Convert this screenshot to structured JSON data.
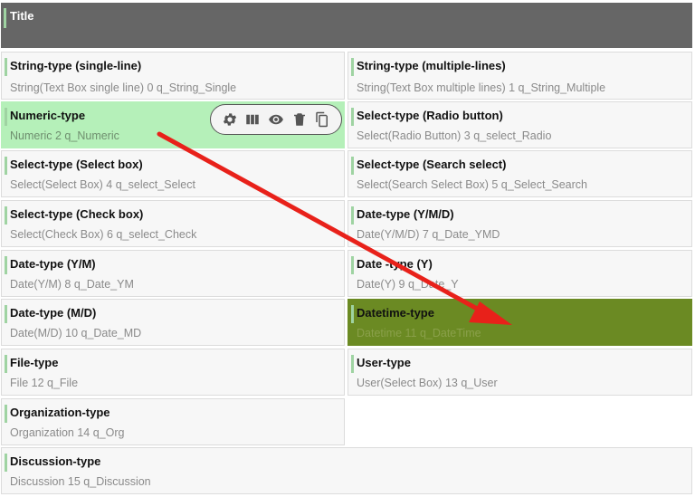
{
  "title": "Title",
  "fields": [
    {
      "label": "String-type (single-line)",
      "desc": "String(Text Box single line) 0 q_String_Single"
    },
    {
      "label": "String-type (multiple-lines)",
      "desc": "String(Text Box multiple lines) 1 q_String_Multiple"
    },
    {
      "label": "Numeric-type",
      "desc": "Numeric 2 q_Numeric"
    },
    {
      "label": "Select-type (Radio button)",
      "desc": "Select(Radio Button) 3 q_select_Radio"
    },
    {
      "label": "Select-type (Select box)",
      "desc": "Select(Select Box) 4 q_select_Select"
    },
    {
      "label": "Select-type (Search select)",
      "desc": "Select(Search Select Box) 5 q_Select_Search"
    },
    {
      "label": "Select-type (Check box)",
      "desc": "Select(Check Box) 6 q_select_Check"
    },
    {
      "label": "Date-type (Y/M/D)",
      "desc": "Date(Y/M/D) 7 q_Date_YMD"
    },
    {
      "label": "Date-type (Y/M)",
      "desc": "Date(Y/M) 8 q_Date_YM"
    },
    {
      "label": "Date -type (Y)",
      "desc": "Date(Y) 9 q_Date_Y"
    },
    {
      "label": "Date-type (M/D)",
      "desc": "Date(M/D) 10 q_Date_MD"
    },
    {
      "label": "Datetime-type",
      "desc": "Datetime 11 q_DateTime"
    },
    {
      "label": "File-type",
      "desc": "File 12 q_File"
    },
    {
      "label": "User-type",
      "desc": "User(Select Box) 13 q_User"
    },
    {
      "label": "Organization-type",
      "desc": "Organization 14 q_Org"
    },
    {
      "label": "Discussion-type",
      "desc": "Discussion 15 q_Discussion"
    }
  ],
  "toolbar_icons": [
    "gear-icon",
    "columns-icon",
    "eye-icon",
    "trash-icon",
    "copy-icon"
  ],
  "colors": {
    "title_bg": "#666666",
    "selected_bg": "#b5f0b9",
    "highlight_bg": "#6b8a23",
    "accent": "#9fd3a2",
    "arrow": "#e8211a"
  }
}
